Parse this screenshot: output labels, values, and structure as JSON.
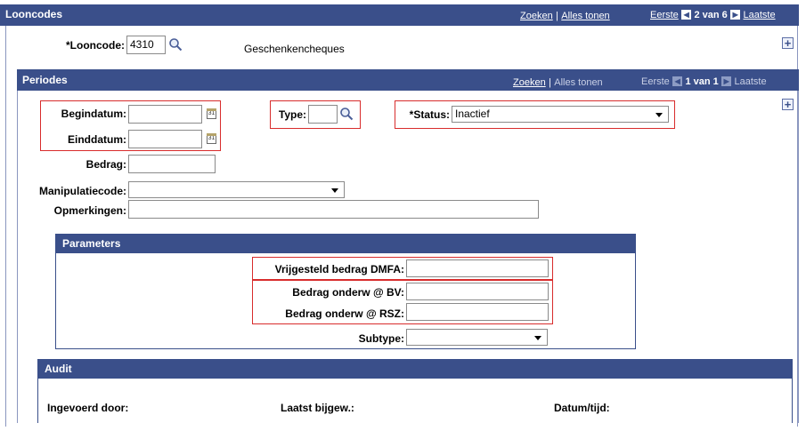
{
  "looncodes": {
    "title": "Looncodes",
    "nav": {
      "zoeken": "Zoeken",
      "sep": "|",
      "alles_tonen": "Alles tonen",
      "eerste": "Eerste",
      "count": "2 van 6",
      "laatste": "Laatste"
    },
    "field_label": "*Looncode:",
    "field_value": "4310",
    "description": "Geschenkencheques"
  },
  "periodes": {
    "title": "Periodes",
    "nav": {
      "zoeken": "Zoeken",
      "sep": "|",
      "alles_tonen": "Alles tonen",
      "eerste": "Eerste",
      "count": "1 van 1",
      "laatste": "Laatste"
    },
    "begindatum": {
      "label": "Begindatum:",
      "value": ""
    },
    "einddatum": {
      "label": "Einddatum:",
      "value": ""
    },
    "calendar_glyph": "31",
    "type": {
      "label": "Type:",
      "value": ""
    },
    "status": {
      "label": "*Status:",
      "value": "Inactief"
    },
    "bedrag": {
      "label": "Bedrag:",
      "value": ""
    },
    "manipulatiecode": {
      "label": "Manipulatiecode:",
      "value": ""
    },
    "opmerkingen": {
      "label": "Opmerkingen:",
      "value": ""
    },
    "add_symbol": "+"
  },
  "parameters": {
    "title": "Parameters",
    "vrijgesteld": {
      "label": "Vrijgesteld bedrag DMFA:",
      "value": ""
    },
    "bedrag_bv": {
      "label": "Bedrag onderw @ BV:",
      "value": ""
    },
    "bedrag_rsz": {
      "label": "Bedrag onderw @ RSZ:",
      "value": ""
    },
    "subtype": {
      "label": "Subtype:",
      "value": ""
    }
  },
  "audit": {
    "title": "Audit",
    "ingevoerd": "Ingevoerd door:",
    "laatst": "Laatst bijgew.:",
    "datum": "Datum/tijd:"
  },
  "icons": {
    "search": "search-icon",
    "calendar": "calendar-icon",
    "add": "add-row-icon",
    "nav_first": "first-arrow-icon",
    "nav_last": "last-arrow-icon",
    "dropdown": "chevron-down-icon"
  },
  "colors": {
    "header": "#3a4f8a",
    "highlight": "#d82c2c"
  }
}
